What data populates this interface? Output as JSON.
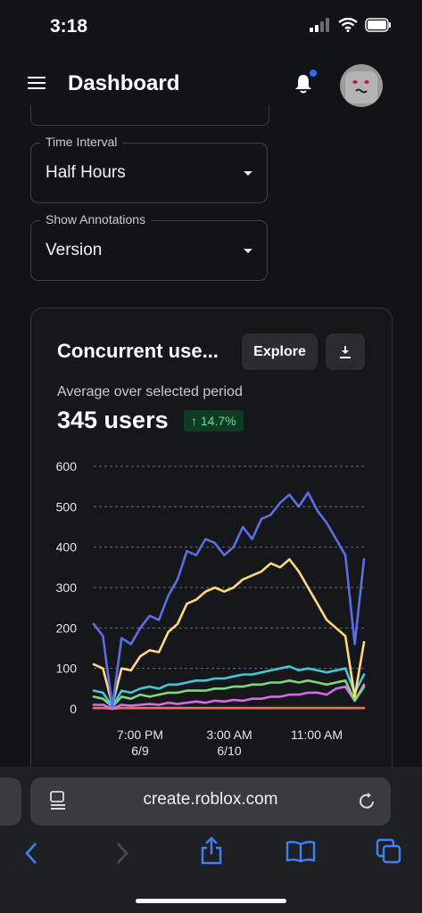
{
  "status": {
    "time": "3:18"
  },
  "header": {
    "title": "Dashboard"
  },
  "filters": [
    {
      "label": "Time Interval",
      "value": "Half Hours"
    },
    {
      "label": "Show Annotations",
      "value": "Version"
    }
  ],
  "card": {
    "title": "Concurrent use...",
    "explore_label": "Explore",
    "metric_caption": "Average over selected period",
    "metric_value": "345 users",
    "badge": "↑ 14.7%"
  },
  "browser": {
    "url": "create.roblox.com"
  },
  "chart_data": {
    "type": "line",
    "yticks": [
      "600",
      "500",
      "400",
      "300",
      "200",
      "100",
      "0"
    ],
    "ylim": [
      0,
      600
    ],
    "xticks": [
      {
        "time": "7:00 PM",
        "date": "6/9"
      },
      {
        "time": "3:00 AM",
        "date": "6/10"
      },
      {
        "time": "11:00 AM",
        "date": ""
      }
    ],
    "grid": true,
    "series": [
      {
        "color": "#5b6ee8",
        "values": [
          210,
          180,
          5,
          175,
          160,
          200,
          230,
          220,
          280,
          320,
          390,
          380,
          420,
          410,
          380,
          400,
          450,
          420,
          470,
          480,
          510,
          530,
          500,
          535,
          490,
          460,
          420,
          380,
          160,
          370
        ]
      },
      {
        "color": "#ffd97a",
        "values": [
          110,
          100,
          10,
          100,
          95,
          130,
          145,
          140,
          190,
          210,
          260,
          270,
          290,
          300,
          290,
          300,
          320,
          330,
          340,
          360,
          350,
          370,
          340,
          300,
          260,
          220,
          200,
          180,
          30,
          165
        ]
      },
      {
        "color": "#45c6d6",
        "values": [
          45,
          40,
          5,
          45,
          40,
          50,
          55,
          50,
          60,
          60,
          65,
          70,
          70,
          75,
          75,
          80,
          85,
          85,
          90,
          95,
          100,
          105,
          95,
          100,
          95,
          90,
          95,
          100,
          40,
          85
        ]
      },
      {
        "color": "#7dd87d",
        "values": [
          30,
          25,
          5,
          30,
          25,
          35,
          30,
          35,
          40,
          40,
          45,
          45,
          45,
          50,
          50,
          55,
          55,
          60,
          60,
          65,
          65,
          70,
          65,
          70,
          65,
          60,
          65,
          70,
          20,
          55
        ]
      },
      {
        "color": "#d46be8",
        "values": [
          10,
          10,
          0,
          10,
          8,
          10,
          12,
          10,
          15,
          12,
          15,
          18,
          15,
          20,
          18,
          22,
          20,
          25,
          25,
          30,
          30,
          35,
          35,
          40,
          40,
          35,
          50,
          55,
          20,
          60
        ]
      },
      {
        "color": "#e8705b",
        "values": [
          2,
          2,
          0,
          2,
          2,
          2,
          2,
          2,
          2,
          2,
          2,
          2,
          2,
          2,
          2,
          2,
          2,
          2,
          2,
          2,
          2,
          2,
          2,
          2,
          2,
          2,
          2,
          2,
          2,
          2
        ]
      }
    ]
  }
}
